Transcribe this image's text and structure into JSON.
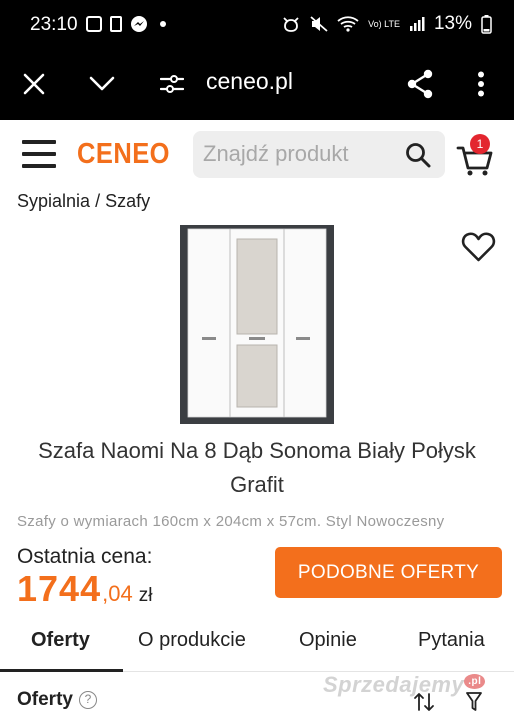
{
  "status_bar": {
    "time": "23:10",
    "battery": "13%",
    "network_label": "Vo) LTE"
  },
  "browser": {
    "url": "ceneo.pl",
    "icons": [
      "close-icon",
      "chevron-down-icon",
      "site-settings-icon",
      "share-icon",
      "more-vert-icon"
    ]
  },
  "header": {
    "logo": "CENEO",
    "search_placeholder": "Znajdź produkt",
    "cart_count": "1",
    "brand_color": "#f36f1c"
  },
  "breadcrumb": {
    "items": [
      "Sypialnia",
      "Szafy"
    ],
    "separator": "/"
  },
  "product": {
    "title": "Szafa Naomi Na 8 Dąb Sonoma Biały Połysk Grafit",
    "description": "Szafy o wymiarach 160cm x 204cm x 57cm. Styl Nowoczesny",
    "last_price_label": "Ostatnia cena:",
    "price_main": "1744",
    "price_decimal": ",04",
    "currency": "zł",
    "similar_button": "PODOBNE OFERTY"
  },
  "tabs": [
    {
      "label": "Oferty",
      "active": true
    },
    {
      "label": "O produkcie",
      "active": false
    },
    {
      "label": "Opinie",
      "active": false
    },
    {
      "label": "Pytania",
      "active": false
    }
  ],
  "offers_section": {
    "title": "Oferty",
    "help": "?"
  },
  "watermark": {
    "text": "Sprzedajemy",
    "suffix": ".pl"
  }
}
